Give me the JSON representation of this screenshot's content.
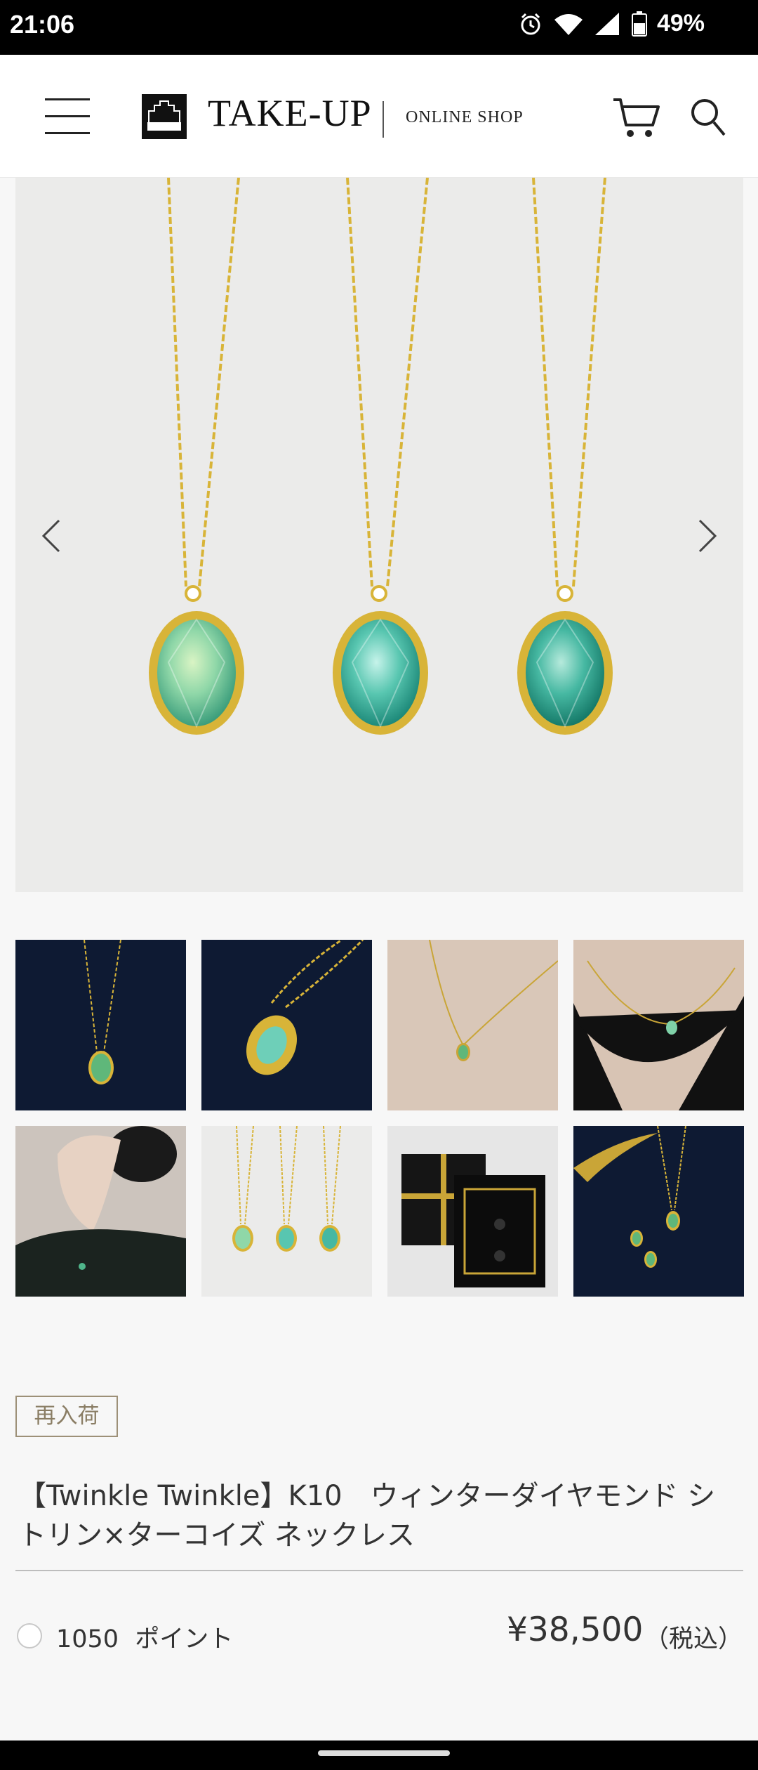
{
  "status_bar": {
    "time": "21:06",
    "battery": "49%"
  },
  "header": {
    "logo_text": "TAKE-UP",
    "logo_sub": "ONLINE SHOP",
    "menu_icon": "hamburger-menu-icon",
    "cart_icon": "cart-icon",
    "search_icon": "search-icon"
  },
  "hero": {
    "prev_icon": "chevron-left-icon",
    "next_icon": "chevron-right-icon"
  },
  "thumbnails": [
    {
      "name": "thumb-necklace-navy-1"
    },
    {
      "name": "thumb-pendant-closeup-navy"
    },
    {
      "name": "thumb-worn-neck-beige"
    },
    {
      "name": "thumb-worn-black-sweater"
    },
    {
      "name": "thumb-model-profile"
    },
    {
      "name": "thumb-three-necklaces"
    },
    {
      "name": "thumb-gift-box"
    },
    {
      "name": "thumb-ribbon-navy"
    }
  ],
  "product": {
    "badge": "再入荷",
    "title": "【Twinkle Twinkle】K10　ウィンターダイヤモンド シトリン×ターコイズ ネックレス",
    "points_value": "1050",
    "points_label": "ポイント",
    "price": "¥38,500",
    "tax_label": "（税込）"
  },
  "colors": {
    "gold": "#d8b438",
    "stone_green": "#7fd1a8",
    "stone_teal": "#3fb8a6",
    "navy": "#0e1a33",
    "badge_border": "#9d9078"
  }
}
